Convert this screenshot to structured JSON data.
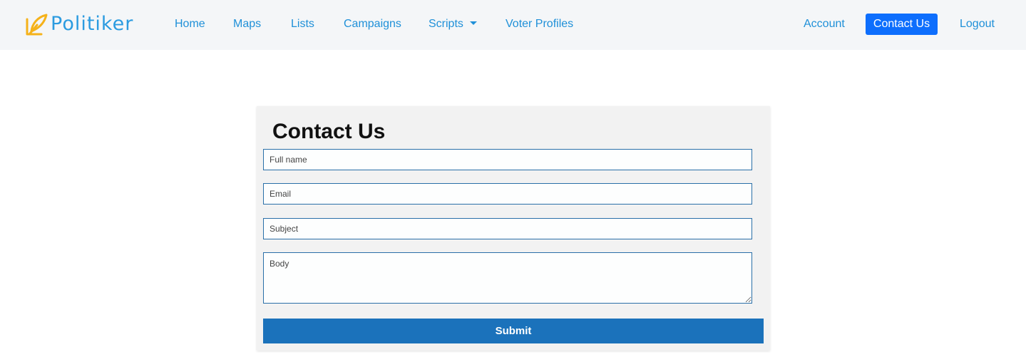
{
  "brand": {
    "logo_icon": "pen-feather-logo-icon",
    "name": "Politiker",
    "color": "#2b9be0",
    "icon_color": "#f5b21a"
  },
  "nav": {
    "home": "Home",
    "maps": "Maps",
    "lists": "Lists",
    "campaigns": "Campaigns",
    "scripts": "Scripts",
    "voter_profiles": "Voter Profiles",
    "account": "Account",
    "contact_us": "Contact Us",
    "logout": "Logout",
    "link_color": "#1f90d8",
    "active_bg": "#0d6efd"
  },
  "form": {
    "title": "Contact Us",
    "full_name_placeholder": "Full name",
    "email_placeholder": "Email",
    "subject_placeholder": "Subject",
    "body_placeholder": "Body",
    "submit_label": "Submit",
    "submit_color": "#1b72bb"
  }
}
